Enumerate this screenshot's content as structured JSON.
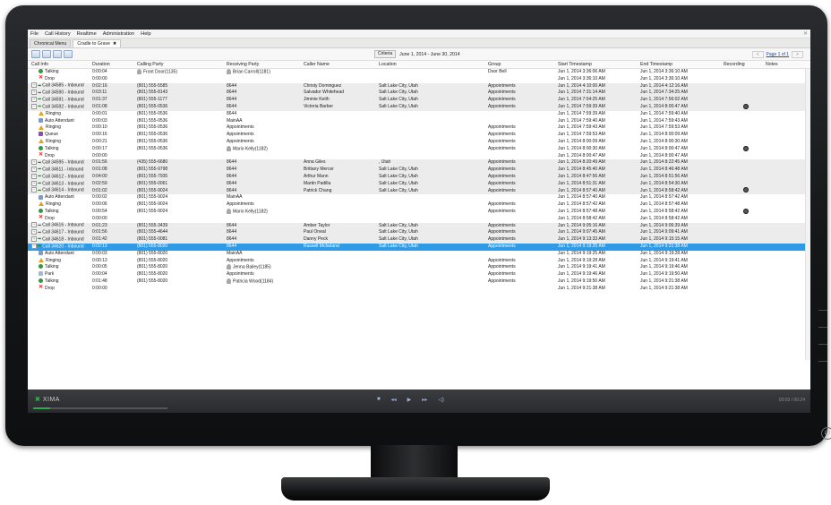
{
  "menu": [
    "File",
    "Call History",
    "Realtime",
    "Administration",
    "Help"
  ],
  "tabs": [
    {
      "label": "Chronical Menu",
      "active": false
    },
    {
      "label": "Cradle to Grave",
      "active": true
    }
  ],
  "toolbar": {
    "criteria_label": "Criteria",
    "date_range": "June 1, 2014 - June 30, 2014",
    "page_prev": "<",
    "page_label": "Page 1 of 1",
    "page_next": ">"
  },
  "columns": [
    "Call Info",
    "Duration",
    "Calling Party",
    "Receiving Party",
    "Caller Name",
    "Location",
    "Group",
    "Start Timestamp",
    "End Timestamp",
    "Recording",
    "Notes"
  ],
  "rows": [
    {
      "kind": "sub",
      "icon": "talking",
      "info": "Talking",
      "duration": "0:00:04",
      "calling": "Front Door(1135)",
      "calling_person": true,
      "receiving": "Brian Carroll(1181)",
      "receiving_person": true,
      "caller_name": "",
      "location": "",
      "group": "Door Bell",
      "start": "Jun 1, 2014 3:36:06 AM",
      "end": "Jun 1, 2014 3:36:10 AM",
      "recording": false
    },
    {
      "kind": "sub",
      "icon": "drop",
      "info": "Drop",
      "duration": "0:00:00",
      "calling": "",
      "calling_person": false,
      "receiving": "",
      "receiving_person": false,
      "caller_name": "",
      "location": "",
      "group": "",
      "start": "Jun 1, 2014 3:36:10 AM",
      "end": "Jun 1, 2014 3:36:10 AM",
      "recording": false
    },
    {
      "kind": "call",
      "icon": "plus",
      "info": "Call 34585 - Inbound",
      "duration": "0:02:16",
      "calling": "(801) 555-5585",
      "calling_person": false,
      "receiving": "8644",
      "receiving_person": false,
      "caller_name": "Christy Dominguez",
      "location": "Salt Lake City, Utah",
      "group": "Appointments",
      "start": "Jun 1, 2014 4:10:00 AM",
      "end": "Jun 1, 2014 4:12:16 AM",
      "recording": false
    },
    {
      "kind": "call",
      "icon": "plus",
      "info": "Call 34590 - Inbound",
      "duration": "0:03:11",
      "calling": "(801) 555-8143",
      "calling_person": false,
      "receiving": "8644",
      "receiving_person": false,
      "caller_name": "Salvador Whitehead",
      "location": "Salt Lake City, Utah",
      "group": "Appointments",
      "start": "Jun 1, 2014 7:31:14 AM",
      "end": "Jun 1, 2014 7:34:25 AM",
      "recording": false
    },
    {
      "kind": "call",
      "icon": "plus",
      "info": "Call 34591 - Inbound",
      "duration": "0:01:37",
      "calling": "(801) 555-1177",
      "calling_person": false,
      "receiving": "8644",
      "receiving_person": false,
      "caller_name": "Jimmie Keith",
      "location": "Salt Lake City, Utah",
      "group": "Appointments",
      "start": "Jun 1, 2014 7:54:25 AM",
      "end": "Jun 1, 2014 7:56:02 AM",
      "recording": false
    },
    {
      "kind": "call",
      "icon": "minus",
      "info": "Call 34592 - Inbound",
      "duration": "0:01:08",
      "calling": "(801) 555-0536",
      "calling_person": false,
      "receiving": "8644",
      "receiving_person": false,
      "caller_name": "Victoria Barber",
      "location": "Salt Lake City, Utah",
      "group": "Appointments",
      "start": "Jun 1, 2014 7:59:39 AM",
      "end": "Jun 1, 2014 8:00:47 AM",
      "recording": true
    },
    {
      "kind": "sub",
      "icon": "ringing",
      "info": "Ringing",
      "duration": "0:00:01",
      "calling": "(801) 555-0536",
      "calling_person": false,
      "receiving": "8644",
      "receiving_person": false,
      "caller_name": "",
      "location": "",
      "group": "",
      "start": "Jun 1, 2014 7:59:39 AM",
      "end": "Jun 1, 2014 7:59:40 AM",
      "recording": false
    },
    {
      "kind": "sub",
      "icon": "aa",
      "info": "Auto Attendant",
      "duration": "0:00:03",
      "calling": "(801) 555-0536",
      "calling_person": false,
      "receiving": "MainAA",
      "receiving_person": false,
      "caller_name": "",
      "location": "",
      "group": "",
      "start": "Jun 1, 2014 7:59:40 AM",
      "end": "Jun 1, 2014 7:59:43 AM",
      "recording": false
    },
    {
      "kind": "sub",
      "icon": "ringing",
      "info": "Ringing",
      "duration": "0:00:10",
      "calling": "(801) 555-0536",
      "calling_person": false,
      "receiving": "Appointments",
      "receiving_person": false,
      "caller_name": "",
      "location": "",
      "group": "Appointments",
      "start": "Jun 1, 2014 7:59:43 AM",
      "end": "Jun 1, 2014 7:59:53 AM",
      "recording": false
    },
    {
      "kind": "sub",
      "icon": "queue",
      "info": "Queue",
      "duration": "0:00:16",
      "calling": "(801) 555-0536",
      "calling_person": false,
      "receiving": "Appointments",
      "receiving_person": false,
      "caller_name": "",
      "location": "",
      "group": "Appointments",
      "start": "Jun 1, 2014 7:59:53 AM",
      "end": "Jun 1, 2014 8:00:09 AM",
      "recording": false
    },
    {
      "kind": "sub",
      "icon": "ringing",
      "info": "Ringing",
      "duration": "0:00:21",
      "calling": "(801) 555-0536",
      "calling_person": false,
      "receiving": "Appointments",
      "receiving_person": false,
      "caller_name": "",
      "location": "",
      "group": "Appointments",
      "start": "Jun 1, 2014 8:00:09 AM",
      "end": "Jun 1, 2014 8:00:30 AM",
      "recording": false
    },
    {
      "kind": "sub",
      "icon": "talking",
      "info": "Talking",
      "duration": "0:00:17",
      "calling": "(801) 555-0536",
      "calling_person": false,
      "receiving": "Mario Kelly(1182)",
      "receiving_person": true,
      "caller_name": "",
      "location": "",
      "group": "Appointments",
      "start": "Jun 1, 2014 8:00:30 AM",
      "end": "Jun 1, 2014 8:00:47 AM",
      "recording": true
    },
    {
      "kind": "sub",
      "icon": "drop",
      "info": "Drop",
      "duration": "0:00:00",
      "calling": "",
      "calling_person": false,
      "receiving": "",
      "receiving_person": false,
      "caller_name": "",
      "location": "",
      "group": "",
      "start": "Jun 1, 2014 8:00:47 AM",
      "end": "Jun 1, 2014 8:00:47 AM",
      "recording": false
    },
    {
      "kind": "call",
      "icon": "plus",
      "info": "Call 34595 - Inbound",
      "duration": "0:01:56",
      "calling": "(435) 555-6680",
      "calling_person": false,
      "receiving": "8644",
      "receiving_person": false,
      "caller_name": "Anna Giles",
      "location": ", Utah",
      "group": "Appointments",
      "start": "Jun 1, 2014 8:20:49 AM",
      "end": "Jun 1, 2014 8:22:45 AM",
      "recording": false
    },
    {
      "kind": "call",
      "icon": "plus",
      "info": "Call 34611 - Inbound",
      "duration": "0:01:08",
      "calling": "(801) 555-9798",
      "calling_person": false,
      "receiving": "8644",
      "receiving_person": false,
      "caller_name": "Brittany Mercer",
      "location": "Salt Lake City, Utah",
      "group": "Appointments",
      "start": "Jun 1, 2014 8:45:40 AM",
      "end": "Jun 1, 2014 8:46:48 AM",
      "recording": false
    },
    {
      "kind": "call",
      "icon": "plus",
      "info": "Call 34612 - Inbound",
      "duration": "0:04:00",
      "calling": "(801) 555-7935",
      "calling_person": false,
      "receiving": "8644",
      "receiving_person": false,
      "caller_name": "Arthur Mann",
      "location": "Salt Lake City, Utah",
      "group": "Appointments",
      "start": "Jun 1, 2014 8:47:56 AM",
      "end": "Jun 1, 2014 8:51:56 AM",
      "recording": false
    },
    {
      "kind": "call",
      "icon": "plus",
      "info": "Call 34613 - Inbound",
      "duration": "0:02:59",
      "calling": "(801) 555-0061",
      "calling_person": false,
      "receiving": "8644",
      "receiving_person": false,
      "caller_name": "Martin Padilla",
      "location": "Salt Lake City, Utah",
      "group": "Appointments",
      "start": "Jun 1, 2014 8:51:31 AM",
      "end": "Jun 1, 2014 8:54:30 AM",
      "recording": false
    },
    {
      "kind": "call",
      "icon": "minus",
      "info": "Call 34614 - Inbound",
      "duration": "0:01:02",
      "calling": "(801) 555-9024",
      "calling_person": false,
      "receiving": "8644",
      "receiving_person": false,
      "caller_name": "Patrick Chang",
      "location": "Salt Lake City, Utah",
      "group": "Appointments",
      "start": "Jun 1, 2014 8:57:40 AM",
      "end": "Jun 1, 2014 8:58:42 AM",
      "recording": true
    },
    {
      "kind": "sub",
      "icon": "aa",
      "info": "Auto Attendant",
      "duration": "0:00:02",
      "calling": "(801) 555-9024",
      "calling_person": false,
      "receiving": "MainAA",
      "receiving_person": false,
      "caller_name": "",
      "location": "",
      "group": "",
      "start": "Jun 1, 2014 8:57:40 AM",
      "end": "Jun 1, 2014 8:57:42 AM",
      "recording": false
    },
    {
      "kind": "sub",
      "icon": "ringing",
      "info": "Ringing",
      "duration": "0:00:06",
      "calling": "(801) 555-9024",
      "calling_person": false,
      "receiving": "Appointments",
      "receiving_person": false,
      "caller_name": "",
      "location": "",
      "group": "Appointments",
      "start": "Jun 1, 2014 8:57:42 AM",
      "end": "Jun 1, 2014 8:57:48 AM",
      "recording": false
    },
    {
      "kind": "sub",
      "icon": "talking",
      "info": "Talking",
      "duration": "0:00:54",
      "calling": "(801) 555-9024",
      "calling_person": false,
      "receiving": "Mario Kelly(1182)",
      "receiving_person": true,
      "caller_name": "",
      "location": "",
      "group": "Appointments",
      "start": "Jun 1, 2014 8:57:48 AM",
      "end": "Jun 1, 2014 8:58:42 AM",
      "recording": true
    },
    {
      "kind": "sub",
      "icon": "drop",
      "info": "Drop",
      "duration": "0:00:00",
      "calling": "",
      "calling_person": false,
      "receiving": "",
      "receiving_person": false,
      "caller_name": "",
      "location": "",
      "group": "",
      "start": "Jun 1, 2014 8:58:42 AM",
      "end": "Jun 1, 2014 8:58:42 AM",
      "recording": false
    },
    {
      "kind": "call",
      "icon": "plus",
      "info": "Call 34616 - Inbound",
      "duration": "0:01:23",
      "calling": "(801) 555-3439",
      "calling_person": false,
      "receiving": "8644",
      "receiving_person": false,
      "caller_name": "Amber Taylor",
      "location": "Salt Lake City, Utah",
      "group": "Appointments",
      "start": "Jun 1, 2014 9:05:16 AM",
      "end": "Jun 1, 2014 9:06:39 AM",
      "recording": false
    },
    {
      "kind": "call",
      "icon": "plus",
      "info": "Call 34617 - Inbound",
      "duration": "0:01:56",
      "calling": "(801) 555-4644",
      "calling_person": false,
      "receiving": "8644",
      "receiving_person": false,
      "caller_name": "Paul Oneal",
      "location": "Salt Lake City, Utah",
      "group": "Appointments",
      "start": "Jun 1, 2014 9:07:45 AM",
      "end": "Jun 1, 2014 9:09:41 AM",
      "recording": false
    },
    {
      "kind": "call",
      "icon": "plus",
      "info": "Call 34618 - Inbound",
      "duration": "0:01:42",
      "calling": "(801) 555-0081",
      "calling_person": false,
      "receiving": "8644",
      "receiving_person": false,
      "caller_name": "Danny Peck",
      "location": "Salt Lake City, Utah",
      "group": "Appointments",
      "start": "Jun 1, 2014 9:13:33 AM",
      "end": "Jun 1, 2014 9:15:15 AM",
      "recording": false
    },
    {
      "kind": "sel",
      "icon": "minus",
      "info": "Call 34620 - Inbound",
      "duration": "0:02:13",
      "calling": "(801) 555-8020",
      "calling_person": false,
      "receiving": "8644",
      "receiving_person": false,
      "caller_name": "Russell Mcfarland",
      "location": "Salt Lake City, Utah",
      "group": "Appointments",
      "start": "Jun 1, 2014 9:19:25 AM",
      "end": "Jun 1, 2014 9:21:38 AM",
      "recording": false
    },
    {
      "kind": "sub",
      "icon": "aa",
      "info": "Auto Attendant",
      "duration": "0:00:03",
      "calling": "(801) 555-8020",
      "calling_person": false,
      "receiving": "MainAA",
      "receiving_person": false,
      "caller_name": "",
      "location": "",
      "group": "",
      "start": "Jun 1, 2014 9:19:25 AM",
      "end": "Jun 1, 2014 9:19:28 AM",
      "recording": false
    },
    {
      "kind": "sub",
      "icon": "ringing",
      "info": "Ringing",
      "duration": "0:00:13",
      "calling": "(801) 555-8020",
      "calling_person": false,
      "receiving": "Appointments",
      "receiving_person": false,
      "caller_name": "",
      "location": "",
      "group": "Appointments",
      "start": "Jun 1, 2014 9:19:28 AM",
      "end": "Jun 1, 2014 9:19:41 AM",
      "recording": false
    },
    {
      "kind": "sub",
      "icon": "talking",
      "info": "Talking",
      "duration": "0:00:05",
      "calling": "(801) 555-8020",
      "calling_person": false,
      "receiving": "Jenna Bailey(1185)",
      "receiving_person": true,
      "caller_name": "",
      "location": "",
      "group": "Appointments",
      "start": "Jun 1, 2014 9:19:41 AM",
      "end": "Jun 1, 2014 9:19:46 AM",
      "recording": false
    },
    {
      "kind": "sub",
      "icon": "park",
      "info": "Park",
      "duration": "0:00:04",
      "calling": "(801) 555-8020",
      "calling_person": false,
      "receiving": "Appointments",
      "receiving_person": false,
      "caller_name": "",
      "location": "",
      "group": "Appointments",
      "start": "Jun 1, 2014 9:19:46 AM",
      "end": "Jun 1, 2014 9:19:50 AM",
      "recording": false
    },
    {
      "kind": "sub",
      "icon": "talking",
      "info": "Talking",
      "duration": "0:01:48",
      "calling": "(801) 555-8020",
      "calling_person": false,
      "receiving": "Patricia Wood(1184)",
      "receiving_person": true,
      "caller_name": "",
      "location": "",
      "group": "Appointments",
      "start": "Jun 1, 2014 9:19:50 AM",
      "end": "Jun 1, 2014 9:21:38 AM",
      "recording": false
    },
    {
      "kind": "sub",
      "icon": "drop",
      "info": "Drop",
      "duration": "0:00:00",
      "calling": "",
      "calling_person": false,
      "receiving": "",
      "receiving_person": false,
      "caller_name": "",
      "location": "",
      "group": "",
      "start": "Jun 1, 2014 9:21:38 AM",
      "end": "Jun 1, 2014 9:21:38 AM",
      "recording": false
    }
  ],
  "player": {
    "logo": "XIMA",
    "timer": "00:03 / 00:24",
    "progress_fraction": 0.125
  }
}
